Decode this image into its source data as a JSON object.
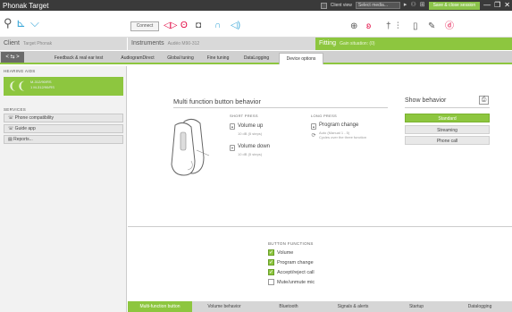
{
  "app": {
    "title": "Phonak Target"
  },
  "titlebar": {
    "client_view_label": "Client view",
    "select_media_label": "Select media...",
    "save_close_label": "Save & close session"
  },
  "toolbar": {
    "connect_label": "Connect"
  },
  "header": {
    "client_label": "Client",
    "client_name": "Target Phonak",
    "instruments_label": "Instruments",
    "instruments_model": "Audéo M90-312",
    "fitting_label": "Fitting",
    "fitting_sub": "Gain situation: (0)"
  },
  "tabs": [
    {
      "label": "Feedback & real ear test"
    },
    {
      "label": "AudiogramDirect"
    },
    {
      "label": "Global tuning"
    },
    {
      "label": "Fine tuning"
    },
    {
      "label": "DataLogging"
    },
    {
      "label": "Device options"
    }
  ],
  "nav": {
    "arrows": "< ⇆ >"
  },
  "sidebar": {
    "hearing_aids_title": "HEARING AIDS",
    "hearing_aids_text1": "M-312/90/RS",
    "hearing_aids_text2": "1 M-312/90/RS",
    "services_title": "SERVICES",
    "services": [
      {
        "label": "Phone compatibility"
      },
      {
        "label": "Guide app"
      },
      {
        "label": "Reports..."
      }
    ]
  },
  "main": {
    "title": "Multi function button behavior",
    "short_press_title": "SHORT PRESS",
    "long_press_title": "LONG PRESS",
    "volume_up": "Volume up",
    "volume_up_sub": "10 dB (5 steps)",
    "volume_down": "Volume down",
    "volume_down_sub": "10 dB (5 steps)",
    "program_change": "Program change",
    "program_change_sub1": "Auto (Manual 1 - 5)",
    "program_change_sub2": "Cycles over the three function"
  },
  "show_behavior": {
    "title": "Show behavior",
    "options": [
      {
        "label": "Standard",
        "active": true
      },
      {
        "label": "Streaming",
        "active": false
      },
      {
        "label": "Phone call",
        "active": false
      }
    ]
  },
  "button_functions": {
    "title": "BUTTON FUNCTIONS",
    "items": [
      {
        "label": "Volume",
        "checked": true
      },
      {
        "label": "Program change",
        "checked": true
      },
      {
        "label": "Accept/reject call",
        "checked": true
      },
      {
        "label": "Mute/unmute mic",
        "checked": false
      }
    ]
  },
  "bottom_tabs": [
    {
      "label": "Multi-function button",
      "active": true
    },
    {
      "label": "Volume behavior",
      "active": false
    },
    {
      "label": "Bluetooth",
      "active": false
    },
    {
      "label": "Signals & alerts",
      "active": false
    },
    {
      "label": "Startup",
      "active": false
    },
    {
      "label": "Datalogging",
      "active": false
    }
  ],
  "colors": {
    "accent_green": "#8dc63f",
    "titlebar_dark": "#3a3a3a",
    "feedback_red": "#e2003d"
  }
}
